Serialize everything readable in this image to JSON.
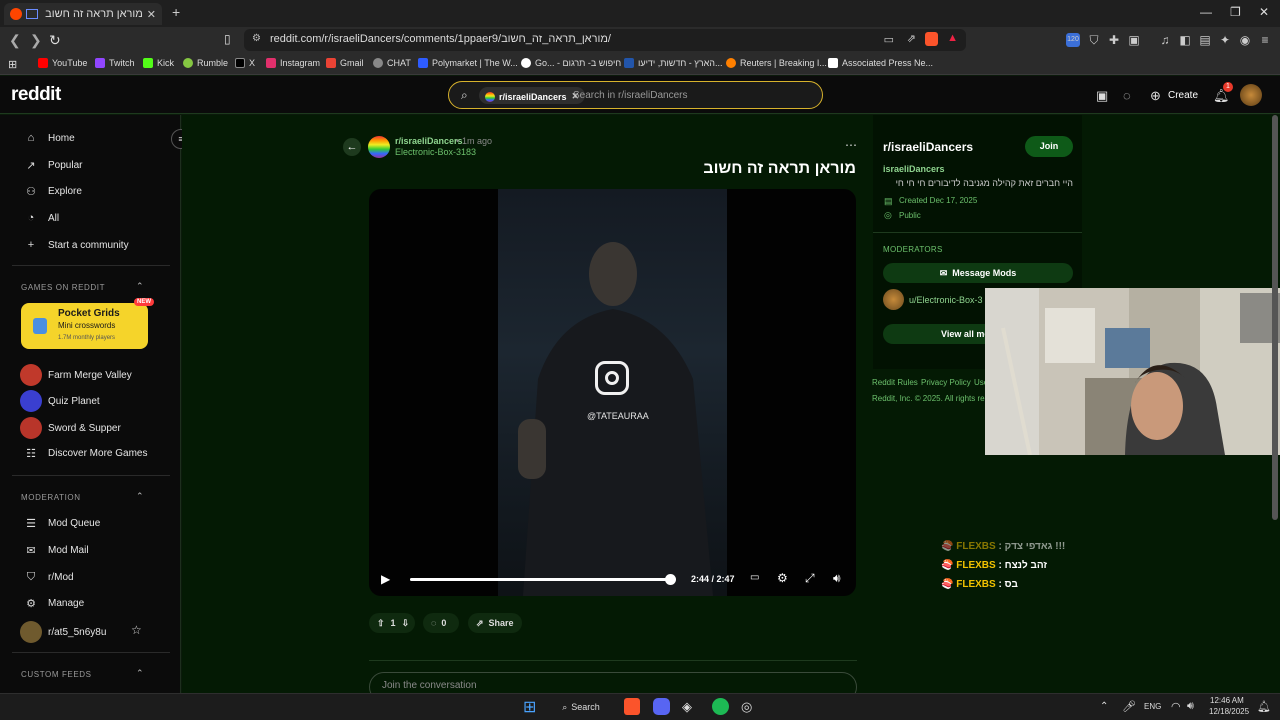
{
  "browser": {
    "tab_title": "מוראן תראה זה חשוב : r/israeliDancers",
    "url": "reddit.com/r/israeliDancers/comments/1ppaer9/מוראן_תראה_זה_חשוב/",
    "bookmarks": [
      {
        "label": "YouTube",
        "color": "#ff0000"
      },
      {
        "label": "Twitch",
        "color": "#9146ff"
      },
      {
        "label": "Kick",
        "color": "#53fc18"
      },
      {
        "label": "Rumble",
        "color": "#85c742"
      },
      {
        "label": "X",
        "color": "#ffffff"
      },
      {
        "label": "Instagram",
        "color": "#e1306c"
      },
      {
        "label": "Gmail",
        "color": "#ea4335"
      },
      {
        "label": "CHAT",
        "color": "#aaaaaa"
      },
      {
        "label": "Polymarket | The W...",
        "color": "#2e5cff"
      },
      {
        "label": "Go... - חיפוש ב- תרגום",
        "color": "#4285f4"
      },
      {
        "label": "הארץ - חדשות, ידיעו...",
        "color": "#2255aa"
      },
      {
        "label": "Reuters | Breaking I...",
        "color": "#ff8000"
      },
      {
        "label": "Associated Press Ne...",
        "color": "#ffffff"
      }
    ]
  },
  "header": {
    "logo": "reddit",
    "search_chip": "r/israeliDancers",
    "search_placeholder": "Search in r/israeliDancers",
    "create_label": "Create",
    "notification_count": "1"
  },
  "sidebar": {
    "nav": [
      "Home",
      "Popular",
      "Explore",
      "All",
      "Start a community"
    ],
    "games_heading": "GAMES ON REDDIT",
    "featured_game": {
      "name": "Pocket Grids",
      "subtitle": "Mini crosswords",
      "players": "1.7M monthly players",
      "badge": "NEW"
    },
    "games": [
      "Farm Merge Valley",
      "Quiz Planet",
      "Sword & Supper",
      "Discover More Games"
    ],
    "moderation_heading": "MODERATION",
    "moderation": [
      "Mod Queue",
      "Mod Mail",
      "r/Mod",
      "Manage",
      "r/at5_5n6y8u"
    ],
    "custom_feeds_heading": "CUSTOM FEEDS"
  },
  "post": {
    "subreddit": "r/israeliDancers",
    "age": "1m ago",
    "author": "Electronic-Box-3183",
    "title": "מוראן תראה זה חשוב",
    "watermark": "@TATEAURAA",
    "time_display": "2:44 / 2:47",
    "progress": 0.98,
    "upvotes": "1",
    "comments": "0",
    "share_label": "Share",
    "comment_placeholder": "Join the conversation"
  },
  "community": {
    "name": "r/israeliDancers",
    "join_label": "Join",
    "display_name": "israeliDancers",
    "description": "היי חברים זאת קהילה מגניבה לדיבורים חי חי חי",
    "created": "Created Dec 17, 2025",
    "visibility": "Public",
    "moderators_heading": "MODERATORS",
    "message_mods": "Message Mods",
    "moderator": "u/Electronic-Box-3",
    "view_all": "View all mo",
    "footer_links": [
      "Reddit Rules",
      "Privacy Policy",
      "Use"
    ],
    "copyright": "Reddit, Inc. © 2025. All rights re"
  },
  "chat_overlay": [
    {
      "user": "FLEXBS",
      "message": "גאדפי צדק !!!"
    },
    {
      "user": "FLEXBS",
      "message": "זהב לנצח"
    },
    {
      "user": "FLEXBS",
      "message": "בס"
    }
  ],
  "taskbar": {
    "search_label": "Search",
    "language": "ENG",
    "time": "12:46 AM",
    "date": "12/18/2025"
  }
}
